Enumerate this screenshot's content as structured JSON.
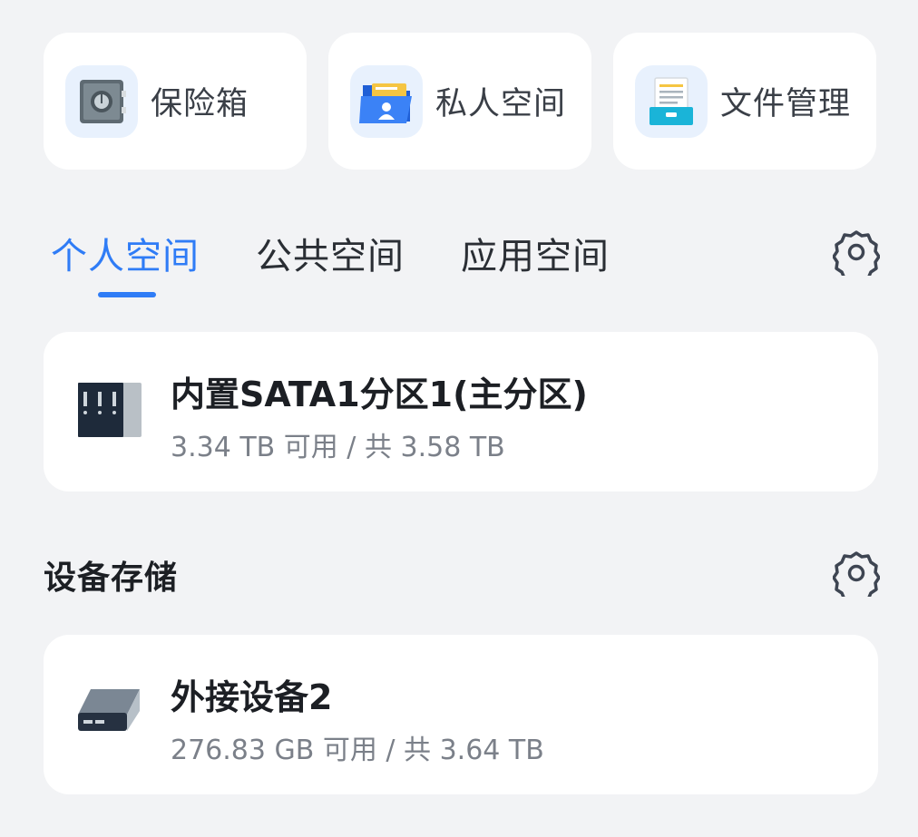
{
  "quick_access": [
    {
      "label": "保险箱",
      "icon": "safe-icon"
    },
    {
      "label": "私人空间",
      "icon": "private-folder-icon"
    },
    {
      "label": "文件管理",
      "icon": "file-manager-icon"
    }
  ],
  "tabs": [
    {
      "label": "个人空间",
      "active": true
    },
    {
      "label": "公共空间",
      "active": false
    },
    {
      "label": "应用空间",
      "active": false
    }
  ],
  "personal_storage": {
    "title": "内置SATA1分区1(主分区)",
    "usage": "3.34 TB 可用 / 共 3.58 TB",
    "icon": "server-disk-icon"
  },
  "device_storage": {
    "section_title": "设备存储",
    "devices": [
      {
        "title": "外接设备2",
        "usage": "276.83 GB 可用 / 共 3.64 TB",
        "icon": "external-drive-icon"
      }
    ]
  },
  "colors": {
    "accent": "#2f7cf6",
    "background": "#f2f3f5",
    "card": "#ffffff"
  }
}
